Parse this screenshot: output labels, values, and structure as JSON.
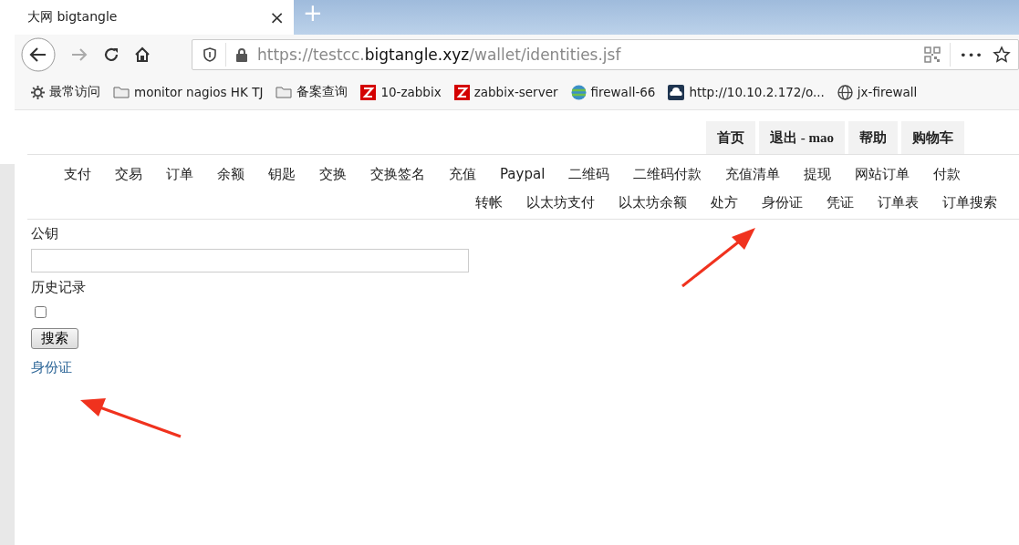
{
  "browser": {
    "tab": {
      "title": "大网 bigtangle",
      "close": "×"
    },
    "new_tab": "+",
    "url": {
      "scheme": "https://testcc.",
      "host": "bigtangle.xyz",
      "path": "/wallet/identities.jsf"
    },
    "menu_dots": "•••"
  },
  "bookmarks": [
    {
      "kind": "gear",
      "label": "最常访问"
    },
    {
      "kind": "folder",
      "label": "monitor nagios HK TJ"
    },
    {
      "kind": "folder",
      "label": "备案查询"
    },
    {
      "kind": "zabbix",
      "label": "10-zabbix"
    },
    {
      "kind": "zabbix",
      "label": "zabbix-server"
    },
    {
      "kind": "sphere",
      "label": "firewall-66"
    },
    {
      "kind": "cloud",
      "label": "http://10.10.2.172/o..."
    },
    {
      "kind": "globe",
      "label": "jx-firewall"
    }
  ],
  "top_nav": [
    "首页",
    "退出 - mao",
    "帮助",
    "购物车"
  ],
  "menu_row_1": [
    "支付",
    "交易",
    "订单",
    "余额",
    "钥匙",
    "交换",
    "交换签名",
    "充值",
    "Paypal",
    "二维码",
    "二维码付款",
    "充值清单",
    "提现",
    "网站订单",
    "付款"
  ],
  "menu_row_2": [
    "转帐",
    "以太坊支付",
    "以太坊余额",
    "处方",
    "身份证",
    "凭证",
    "订单表",
    "订单搜索"
  ],
  "form": {
    "public_key_label": "公钥",
    "history_label": "历史记录",
    "history_checked": false,
    "search_button": "搜索",
    "result_link": "身份证"
  }
}
